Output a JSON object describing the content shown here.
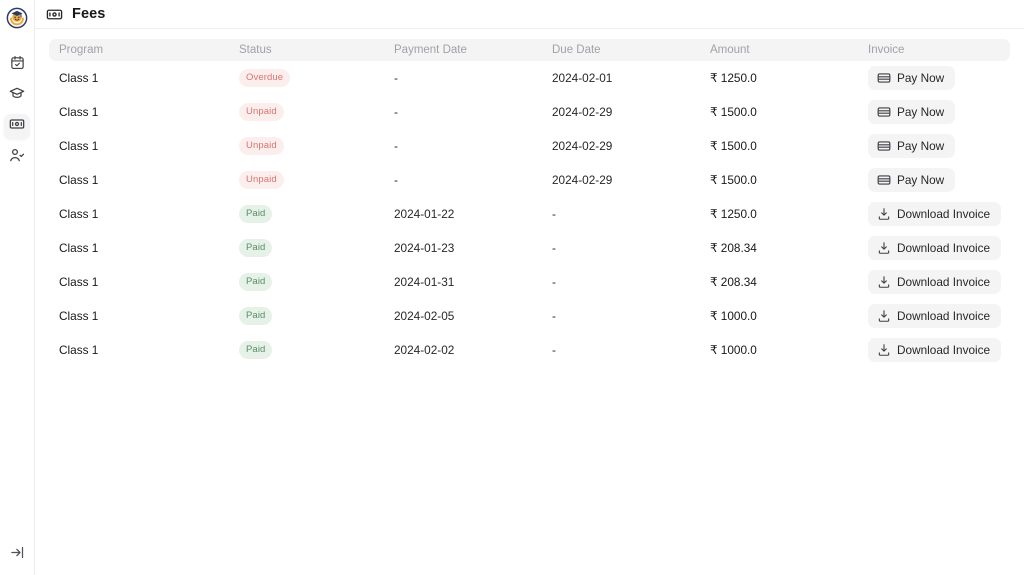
{
  "app": {
    "logo_name": "graduation-cap-avatar-logo"
  },
  "sidebar": {
    "items": [
      {
        "name": "calendar-check-icon",
        "label": "Attendance"
      },
      {
        "name": "graduation-cap-icon",
        "label": "Programs"
      },
      {
        "name": "banknote-icon",
        "label": "Fees",
        "active": true
      },
      {
        "name": "user-check-icon",
        "label": "Enrollment"
      }
    ],
    "collapse_label": "Expand sidebar"
  },
  "header": {
    "icon": "banknote-icon",
    "title": "Fees"
  },
  "table": {
    "columns": [
      "Program",
      "Status",
      "Payment Date",
      "Due Date",
      "Amount",
      "Invoice"
    ],
    "rows": [
      {
        "program": "Class 1",
        "status": "Overdue",
        "status_kind": "overdue",
        "payment_date": "-",
        "due_date": "2024-02-01",
        "amount": "₹ 1250.0",
        "action_label": "Pay Now",
        "action_icon": "credit-card-icon",
        "action_kind": "pay"
      },
      {
        "program": "Class 1",
        "status": "Unpaid",
        "status_kind": "unpaid",
        "payment_date": "-",
        "due_date": "2024-02-29",
        "amount": "₹ 1500.0",
        "action_label": "Pay Now",
        "action_icon": "credit-card-icon",
        "action_kind": "pay"
      },
      {
        "program": "Class 1",
        "status": "Unpaid",
        "status_kind": "unpaid",
        "payment_date": "-",
        "due_date": "2024-02-29",
        "amount": "₹ 1500.0",
        "action_label": "Pay Now",
        "action_icon": "credit-card-icon",
        "action_kind": "pay"
      },
      {
        "program": "Class 1",
        "status": "Unpaid",
        "status_kind": "unpaid",
        "payment_date": "-",
        "due_date": "2024-02-29",
        "amount": "₹ 1500.0",
        "action_label": "Pay Now",
        "action_icon": "credit-card-icon",
        "action_kind": "pay"
      },
      {
        "program": "Class 1",
        "status": "Paid",
        "status_kind": "paid",
        "payment_date": "2024-01-22",
        "due_date": "-",
        "amount": "₹ 1250.0",
        "action_label": "Download Invoice",
        "action_icon": "download-icon",
        "action_kind": "download"
      },
      {
        "program": "Class 1",
        "status": "Paid",
        "status_kind": "paid",
        "payment_date": "2024-01-23",
        "due_date": "-",
        "amount": "₹ 208.34",
        "action_label": "Download Invoice",
        "action_icon": "download-icon",
        "action_kind": "download"
      },
      {
        "program": "Class 1",
        "status": "Paid",
        "status_kind": "paid",
        "payment_date": "2024-01-31",
        "due_date": "-",
        "amount": "₹ 208.34",
        "action_label": "Download Invoice",
        "action_icon": "download-icon",
        "action_kind": "download"
      },
      {
        "program": "Class 1",
        "status": "Paid",
        "status_kind": "paid",
        "payment_date": "2024-02-05",
        "due_date": "-",
        "amount": "₹ 1000.0",
        "action_label": "Download Invoice",
        "action_icon": "download-icon",
        "action_kind": "download"
      },
      {
        "program": "Class 1",
        "status": "Paid",
        "status_kind": "paid",
        "payment_date": "2024-02-02",
        "due_date": "-",
        "amount": "₹ 1000.0",
        "action_label": "Download Invoice",
        "action_icon": "download-icon",
        "action_kind": "download"
      }
    ]
  },
  "colors": {
    "badge_negative_bg": "#fdeeee",
    "badge_negative_fg": "#d9756f",
    "badge_positive_bg": "#e6f2e8",
    "badge_positive_fg": "#5b8b68",
    "header_bg": "#f4f4f5",
    "button_bg": "#f4f4f5",
    "text": "#18181b",
    "muted_text": "#a1a1aa",
    "logo_primary": "#2b3a67",
    "logo_accent": "#f0a93b"
  }
}
